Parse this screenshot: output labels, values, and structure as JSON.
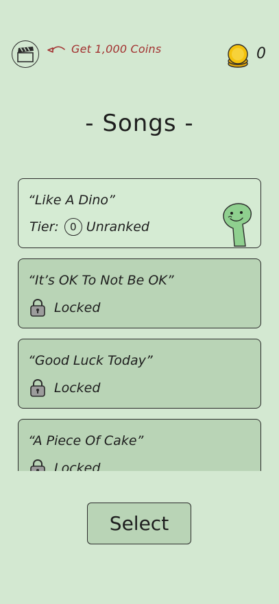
{
  "header": {
    "ad_hint": "Get 1,000 Coins",
    "coin_count": "0"
  },
  "page_title": "- Songs -",
  "songs": [
    {
      "title": "“Like A Dino”",
      "status": "unranked",
      "tier_label": "Tier:",
      "tier_value": "0",
      "tier_text": "Unranked"
    },
    {
      "title": "“It’s OK To Not Be OK”",
      "status": "locked",
      "status_text": "Locked"
    },
    {
      "title": "“Good Luck Today”",
      "status": "locked",
      "status_text": "Locked"
    },
    {
      "title": "“A Piece Of Cake”",
      "status": "locked",
      "status_text": "Locked"
    }
  ],
  "select_label": "Select",
  "colors": {
    "background": "#d3e8d1",
    "card_locked": "#b9d4b6",
    "card_selected": "#d5ebd3",
    "accent_red": "#a2302f",
    "coin_gold": "#f4c20d",
    "dino_green": "#8fd08f"
  },
  "icons": {
    "ad": "clapperboard-icon",
    "arrow": "curved-arrow-left-icon",
    "coin": "coin-stack-icon",
    "lock": "padlock-icon",
    "mascot": "dino-mascot"
  }
}
